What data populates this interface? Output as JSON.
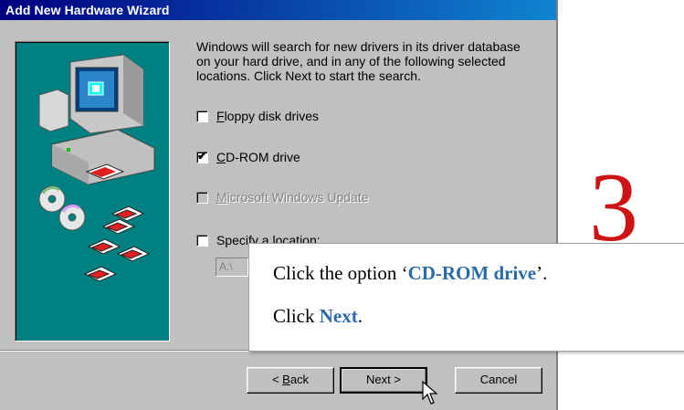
{
  "window": {
    "title": "Add New Hardware Wizard"
  },
  "intro_text": "Windows will search for new drivers in its driver database\non your hard drive, and in any of the following selected\nlocations. Click Next to start the search.",
  "options": [
    {
      "key": "F",
      "rest": "loppy disk drives",
      "checked": false,
      "enabled": true
    },
    {
      "key": "C",
      "rest": "D-ROM drive",
      "checked": true,
      "enabled": true
    },
    {
      "key": "M",
      "rest": "icrosoft Windows Update",
      "checked": false,
      "enabled": false
    },
    {
      "pre": "Specify a ",
      "key": "l",
      "rest": "ocation:",
      "checked": false,
      "enabled": true
    }
  ],
  "location_value": "A:\\",
  "buttons": {
    "back_key": "B",
    "back_rest": "ack",
    "back_prefix": "< ",
    "next": "Next >",
    "cancel": "Cancel"
  },
  "callout": {
    "line1_pre": "Click the option ‘",
    "line1_hl": "CD-ROM drive",
    "line1_post": "’.",
    "line2_pre": "Click ",
    "line2_hl": "Next",
    "line2_post": "."
  },
  "step_number": "3",
  "colors": {
    "title_gradient_start": "#000080",
    "title_gradient_end": "#1084d0",
    "panel": "#008080",
    "highlight": "#2a6aa8",
    "step_number": "#cc1414"
  }
}
